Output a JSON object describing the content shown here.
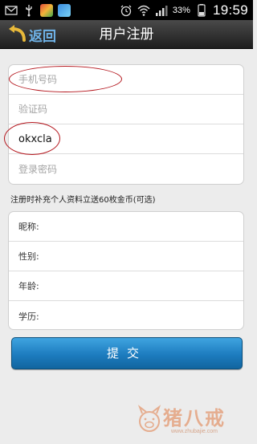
{
  "status_bar": {
    "battery": "33%",
    "time": "19:59",
    "icons": [
      "mail-icon",
      "usb-icon",
      "app-icon-1",
      "app-icon-2",
      "alarm-icon",
      "wifi-icon",
      "signal-icon",
      "battery-icon"
    ]
  },
  "header": {
    "back_label": "返回",
    "title": "用户注册"
  },
  "form_main": {
    "phone_placeholder": "手机号码",
    "code_placeholder": "验证码",
    "name_value": "okxcla",
    "password_placeholder": "登录密码"
  },
  "note": "注册时补充个人资料立送60枚金币(可选)",
  "form_profile": {
    "nickname_label": "昵称:",
    "gender_label": "性别:",
    "age_label": "年龄:",
    "education_label": "学历:"
  },
  "submit_label": "提交",
  "watermark": {
    "title": "猪八戒",
    "url": "www.zhubajie.com"
  },
  "colors": {
    "accent": "#1d7cbf",
    "back_text": "#6fb3e8",
    "annotation": "#b4161d"
  }
}
